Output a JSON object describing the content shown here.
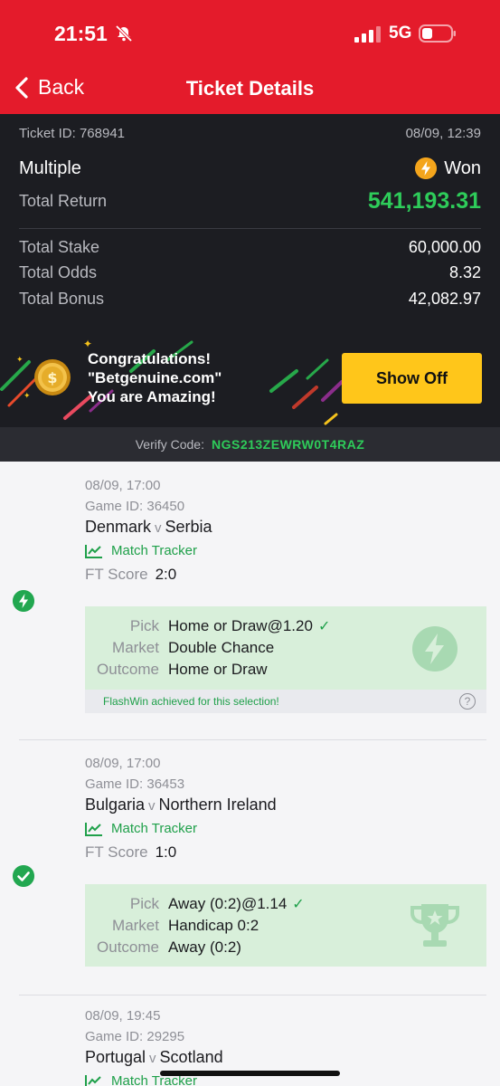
{
  "status_bar": {
    "time": "21:51",
    "network": "5G"
  },
  "nav": {
    "back_label": "Back",
    "title": "Ticket Details"
  },
  "ticket": {
    "id": "Ticket ID: 768941",
    "datetime": "08/09, 12:39",
    "type": "Multiple",
    "status": "Won",
    "total_return_label": "Total Return",
    "total_return": "541,193.31",
    "total_stake_label": "Total Stake",
    "total_stake": "60,000.00",
    "total_odds_label": "Total Odds",
    "total_odds": "8.32",
    "total_bonus_label": "Total Bonus",
    "total_bonus": "42,082.97"
  },
  "promo": {
    "line1": "Congratulations!",
    "line2": "\"Betgenuine.com\"",
    "line3": "You are Amazing!",
    "show_off": "Show Off"
  },
  "verify": {
    "label": "Verify Code:",
    "code": "NGS213ZEWRW0T4RAZ"
  },
  "bets": [
    {
      "date": "08/09, 17:00",
      "game_id": "Game ID: 36450",
      "home": "Denmark",
      "vs": "v",
      "away": "Serbia",
      "tracker": "Match Tracker",
      "ft_label": "FT Score",
      "ft_score": "2:0",
      "pick_label": "Pick",
      "pick": "Home or Draw@1.20",
      "market_label": "Market",
      "market": "Double Chance",
      "outcome_label": "Outcome",
      "outcome": "Home or Draw",
      "note": "FlashWin achieved for this selection!"
    },
    {
      "date": "08/09, 17:00",
      "game_id": "Game ID: 36453",
      "home": "Bulgaria",
      "vs": "v",
      "away": "Northern Ireland",
      "tracker": "Match Tracker",
      "ft_label": "FT Score",
      "ft_score": "1:0",
      "pick_label": "Pick",
      "pick": "Away (0:2)@1.14",
      "market_label": "Market",
      "market": "Handicap 0:2",
      "outcome_label": "Outcome",
      "outcome": "Away (0:2)"
    },
    {
      "date": "08/09, 19:45",
      "game_id": "Game ID: 29295",
      "home": "Portugal",
      "vs": "v",
      "away": "Scotland",
      "tracker": "Match Tracker"
    }
  ],
  "colors": {
    "brand_red": "#e41b2b",
    "win_green": "#2ecc5a",
    "show_off_yellow": "#ffc61a"
  }
}
